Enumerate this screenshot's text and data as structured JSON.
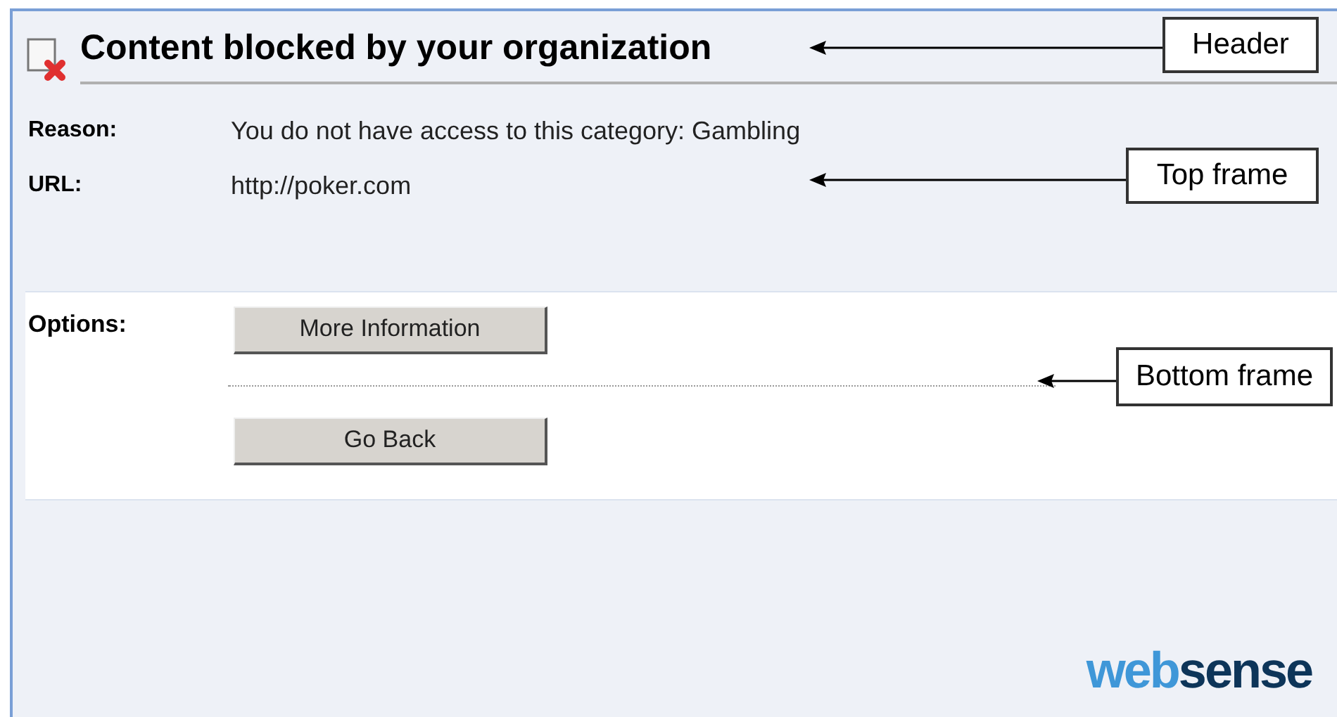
{
  "header": {
    "title": "Content blocked by your organization"
  },
  "top_frame": {
    "rows": [
      {
        "label": "Reason:",
        "value": "You do not have access to this category: Gambling"
      },
      {
        "label": "URL:",
        "value": "http://poker.com"
      }
    ]
  },
  "bottom_frame": {
    "label": "Options:",
    "buttons": [
      "More Information",
      "Go Back"
    ]
  },
  "logo": {
    "part_1": "web",
    "part_2": "sense"
  },
  "callouts": [
    {
      "text": "Header"
    },
    {
      "text": "Top frame"
    },
    {
      "text": "Bottom frame"
    }
  ]
}
